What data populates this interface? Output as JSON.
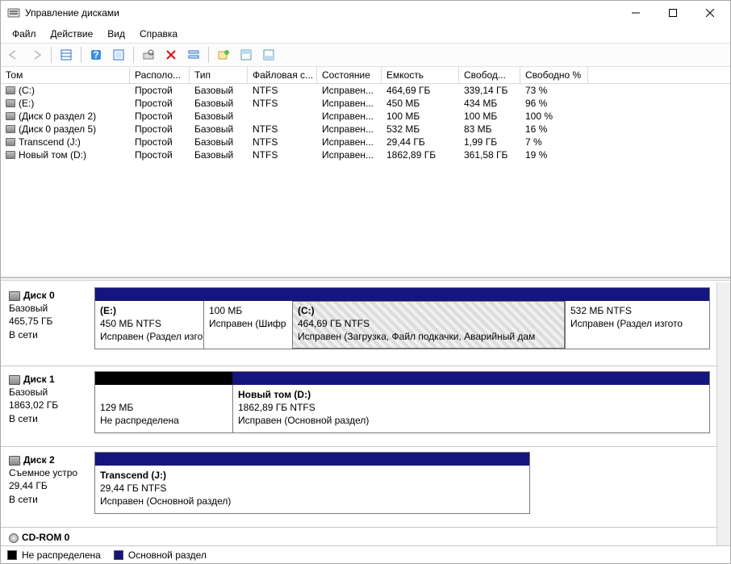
{
  "window": {
    "title": "Управление дисками"
  },
  "menu": {
    "file": "Файл",
    "action": "Действие",
    "view": "Вид",
    "help": "Справка"
  },
  "columns": {
    "volume": "Том",
    "layout": "Располо...",
    "type": "Тип",
    "fs": "Файловая с...",
    "status": "Состояние",
    "capacity": "Емкость",
    "free": "Свобод...",
    "pct": "Свободно %"
  },
  "volumes": [
    {
      "name": "(C:)",
      "layout": "Простой",
      "type": "Базовый",
      "fs": "NTFS",
      "status": "Исправен...",
      "capacity": "464,69 ГБ",
      "free": "339,14 ГБ",
      "pct": "73 %"
    },
    {
      "name": "(E:)",
      "layout": "Простой",
      "type": "Базовый",
      "fs": "NTFS",
      "status": "Исправен...",
      "capacity": "450 МБ",
      "free": "434 МБ",
      "pct": "96 %"
    },
    {
      "name": "(Диск 0 раздел 2)",
      "layout": "Простой",
      "type": "Базовый",
      "fs": "",
      "status": "Исправен...",
      "capacity": "100 МБ",
      "free": "100 МБ",
      "pct": "100 %"
    },
    {
      "name": "(Диск 0 раздел 5)",
      "layout": "Простой",
      "type": "Базовый",
      "fs": "NTFS",
      "status": "Исправен...",
      "capacity": "532 МБ",
      "free": "83 МБ",
      "pct": "16 %"
    },
    {
      "name": "Transcend (J:)",
      "layout": "Простой",
      "type": "Базовый",
      "fs": "NTFS",
      "status": "Исправен...",
      "capacity": "29,44 ГБ",
      "free": "1,99 ГБ",
      "pct": "7 %"
    },
    {
      "name": "Новый том (D:)",
      "layout": "Простой",
      "type": "Базовый",
      "fs": "NTFS",
      "status": "Исправен...",
      "capacity": "1862,89 ГБ",
      "free": "361,58 ГБ",
      "pct": "19 %"
    }
  ],
  "disks": {
    "d0": {
      "title": "Диск 0",
      "type": "Базовый",
      "size": "465,75 ГБ",
      "status": "В сети",
      "parts": [
        {
          "name": "(E:)",
          "line2": "450 МБ NTFS",
          "line3": "Исправен (Раздел изго"
        },
        {
          "name": "",
          "line2": "100 МБ",
          "line3": "Исправен (Шифр"
        },
        {
          "name": "(C:)",
          "line2": "464,69 ГБ NTFS",
          "line3": "Исправен (Загрузка, Файл подкачки, Аварийный дам"
        },
        {
          "name": "",
          "line2": "532 МБ NTFS",
          "line3": "Исправен (Раздел изгото"
        }
      ]
    },
    "d1": {
      "title": "Диск 1",
      "type": "Базовый",
      "size": "1863,02 ГБ",
      "status": "В сети",
      "unalloc": {
        "line2": "129 МБ",
        "line3": "Не распределена"
      },
      "part": {
        "name": "Новый том  (D:)",
        "line2": "1862,89 ГБ NTFS",
        "line3": "Исправен (Основной раздел)"
      }
    },
    "d2": {
      "title": "Диск 2",
      "type": "Съемное устро",
      "size": "29,44 ГБ",
      "status": "В сети",
      "part": {
        "name": "Transcend  (J:)",
        "line2": "29,44 ГБ NTFS",
        "line3": "Исправен (Основной раздел)"
      }
    },
    "cdrom": {
      "title": "CD-ROM 0"
    }
  },
  "legend": {
    "unalloc": "Не распределена",
    "primary": "Основной раздел"
  }
}
